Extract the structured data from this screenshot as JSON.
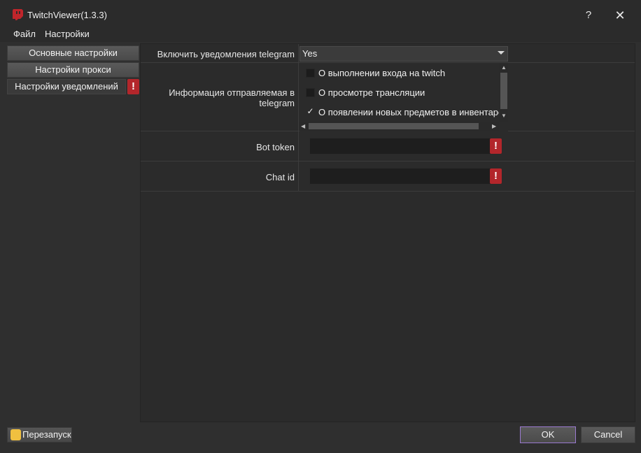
{
  "window": {
    "title": "TwitchViewer(1.3.3)",
    "help": "?",
    "close": "✕"
  },
  "menu": {
    "items": [
      {
        "label": "Файл"
      },
      {
        "label": "Настройки"
      }
    ]
  },
  "sidebar": {
    "items": [
      {
        "label": "Основные настройки"
      },
      {
        "label": "Настройки прокси"
      },
      {
        "label": "Настройки уведомлений"
      }
    ],
    "warning": "!"
  },
  "settings": {
    "enable_label": "Включить уведомления telegram",
    "enable_value": "Yes",
    "info_label_line1": "Информация отправляемая в",
    "info_label_line2": "telegram",
    "options": [
      {
        "label": "О выполнении входа на twitch",
        "checked": false
      },
      {
        "label": "О просмотре трансляции",
        "checked": false
      },
      {
        "label": "О появлении новых предметов в инвентаре",
        "checked": true
      }
    ],
    "check_mark": "✓",
    "bot_token_label": "Bot token",
    "bot_token_value": "",
    "chat_id_label": "Chat id",
    "chat_id_value": "",
    "warning": "!"
  },
  "footer": {
    "restart_label": "Перезапуск",
    "ok_label": "OK",
    "cancel_label": "Cancel"
  },
  "colors": {
    "accent_border": "#9a7ad0",
    "warning": "#b3262b"
  }
}
